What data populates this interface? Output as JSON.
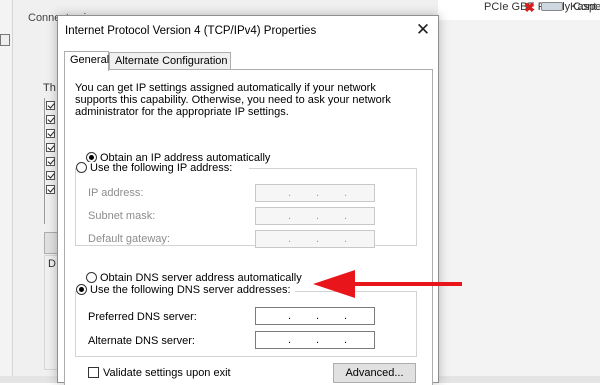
{
  "background": {
    "connection_label": "Connect using:",
    "adapter_text": "PCIe GBE Family Cont...",
    "kaspersky_text": "Kaspe",
    "this_label": "Th",
    "description_letter": "D"
  },
  "dialog": {
    "title": "Internet Protocol Version 4 (TCP/IPv4) Properties",
    "close_label": "✕",
    "tabs": [
      {
        "label": "General"
      },
      {
        "label": "Alternate Configuration"
      }
    ],
    "info_text": "You can get IP settings assigned automatically if your network supports this capability. Otherwise, you need to ask your network administrator for the appropriate IP settings.",
    "ip": {
      "auto_label": "Obtain an IP address automatically",
      "manual_label": "Use the following IP address:",
      "fields": [
        {
          "label": "IP address:",
          "value": ". . ."
        },
        {
          "label": "Subnet mask:",
          "value": ". . ."
        },
        {
          "label": "Default gateway:",
          "value": ". . ."
        }
      ]
    },
    "dns": {
      "auto_label": "Obtain DNS server address automatically",
      "manual_label": "Use the following DNS server addresses:",
      "fields": [
        {
          "label": "Preferred DNS server:",
          "value": ". . ."
        },
        {
          "label": "Alternate DNS server:",
          "value": ". . ."
        }
      ]
    },
    "validate_label": "Validate settings upon exit",
    "advanced_label": "Advanced..."
  },
  "colors": {
    "annotation_arrow": "#e8161a",
    "dialog_background": "#ffffff"
  }
}
